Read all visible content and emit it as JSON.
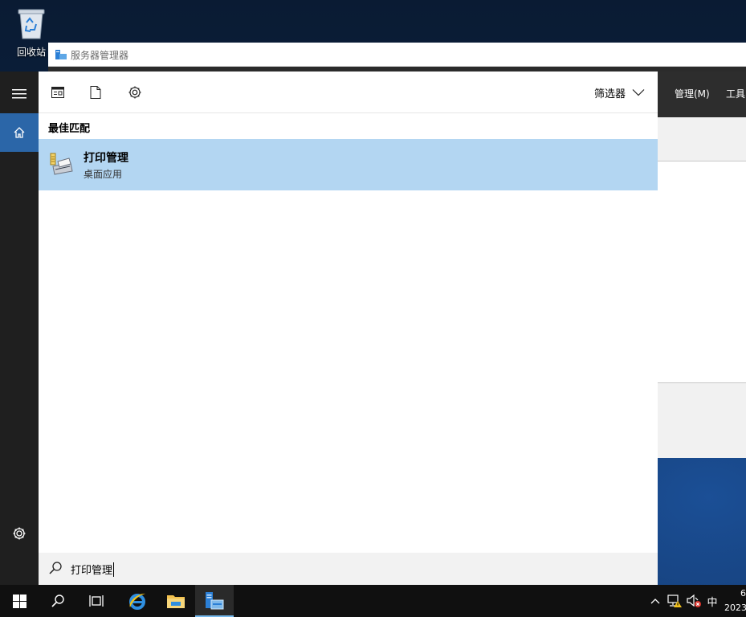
{
  "desktop": {
    "recycle_bin_label": "回收站"
  },
  "server_manager": {
    "title": "服务器管理器",
    "menu": {
      "manage": "管理(M)",
      "tools": "工具"
    }
  },
  "start_rail": {
    "items": [
      {
        "name": "expand",
        "icon": "hamburger-icon"
      },
      {
        "name": "home",
        "icon": "home-icon",
        "active": true
      },
      {
        "name": "settings",
        "icon": "gear-icon"
      }
    ]
  },
  "search_panel": {
    "toolbar": {
      "icons": [
        "apps-icon",
        "documents-icon",
        "settings-icon"
      ],
      "filter_label": "筛选器"
    },
    "section_header": "最佳匹配",
    "best_match": {
      "title": "打印管理",
      "subtitle": "桌面应用",
      "icon": "print-management-icon"
    },
    "search_box": {
      "query": "打印管理"
    }
  },
  "taskbar": {
    "buttons": [
      "windows-start-icon",
      "search-icon",
      "task-view-icon",
      "internet-explorer-icon",
      "file-explorer-icon",
      "server-manager-icon"
    ],
    "active_button": "server-manager-icon",
    "tray": {
      "ime": "中",
      "clock_line1": "6",
      "clock_line2": "2023"
    }
  },
  "colors": {
    "selection": "#b3d6f2",
    "rail_active": "#2b66a8",
    "taskbar": "#101010"
  }
}
